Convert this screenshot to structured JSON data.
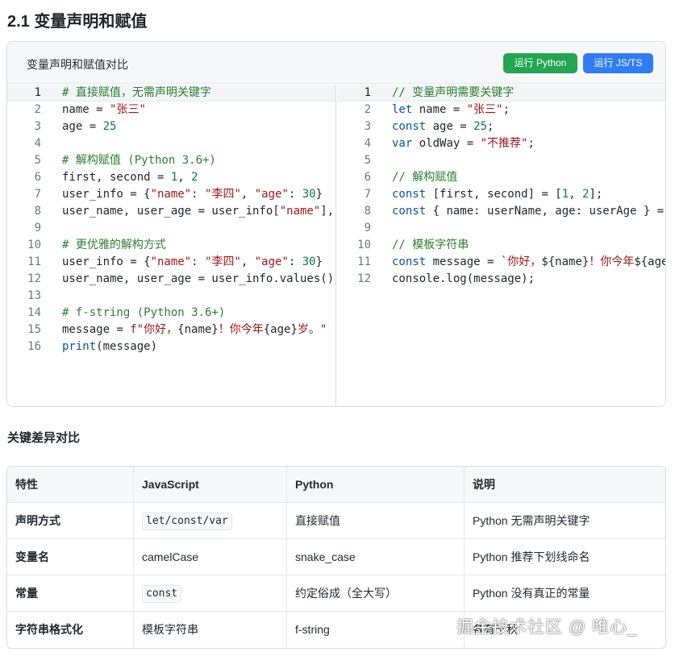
{
  "page": {
    "section_title": "2.1 变量声明和赋值",
    "watermark": "掘金技术社区 @ 唯心_"
  },
  "card": {
    "title": "变量声明和赋值对比",
    "run_python": "运行 Python",
    "run_js": "运行 JS/TS"
  },
  "code_python": [
    {
      "n": "1",
      "tokens": [
        {
          "t": "# 直接赋值，无需声明关键字",
          "c": "comment"
        }
      ]
    },
    {
      "n": "2",
      "tokens": [
        {
          "t": "name = ",
          "c": "plain"
        },
        {
          "t": "\"张三\"",
          "c": "str"
        }
      ]
    },
    {
      "n": "3",
      "tokens": [
        {
          "t": "age = ",
          "c": "plain"
        },
        {
          "t": "25",
          "c": "num"
        }
      ]
    },
    {
      "n": "4",
      "tokens": []
    },
    {
      "n": "5",
      "tokens": [
        {
          "t": "# 解构赋值 (Python 3.6+)",
          "c": "comment"
        }
      ]
    },
    {
      "n": "6",
      "tokens": [
        {
          "t": "first, second = ",
          "c": "plain"
        },
        {
          "t": "1",
          "c": "num"
        },
        {
          "t": ", ",
          "c": "plain"
        },
        {
          "t": "2",
          "c": "num"
        }
      ]
    },
    {
      "n": "7",
      "tokens": [
        {
          "t": "user_info = {",
          "c": "plain"
        },
        {
          "t": "\"name\"",
          "c": "str"
        },
        {
          "t": ": ",
          "c": "plain"
        },
        {
          "t": "\"李四\"",
          "c": "str"
        },
        {
          "t": ", ",
          "c": "plain"
        },
        {
          "t": "\"age\"",
          "c": "str"
        },
        {
          "t": ": ",
          "c": "plain"
        },
        {
          "t": "30",
          "c": "num"
        },
        {
          "t": "}",
          "c": "plain"
        }
      ]
    },
    {
      "n": "8",
      "tokens": [
        {
          "t": "user_name, user_age = user_info[",
          "c": "plain"
        },
        {
          "t": "\"name\"",
          "c": "str"
        },
        {
          "t": "],",
          "c": "plain"
        }
      ]
    },
    {
      "n": "9",
      "tokens": []
    },
    {
      "n": "10",
      "tokens": [
        {
          "t": "# 更优雅的解构方式",
          "c": "comment"
        }
      ]
    },
    {
      "n": "11",
      "tokens": [
        {
          "t": "user_info = {",
          "c": "plain"
        },
        {
          "t": "\"name\"",
          "c": "str"
        },
        {
          "t": ": ",
          "c": "plain"
        },
        {
          "t": "\"李四\"",
          "c": "str"
        },
        {
          "t": ", ",
          "c": "plain"
        },
        {
          "t": "\"age\"",
          "c": "str"
        },
        {
          "t": ": ",
          "c": "plain"
        },
        {
          "t": "30",
          "c": "num"
        },
        {
          "t": "}",
          "c": "plain"
        }
      ]
    },
    {
      "n": "12",
      "tokens": [
        {
          "t": "user_name, user_age = user_info.values()",
          "c": "plain"
        }
      ]
    },
    {
      "n": "13",
      "tokens": []
    },
    {
      "n": "14",
      "tokens": [
        {
          "t": "# f-string (Python 3.6+)",
          "c": "comment"
        }
      ]
    },
    {
      "n": "15",
      "tokens": [
        {
          "t": "message = ",
          "c": "plain"
        },
        {
          "t": "f\"你好，",
          "c": "str"
        },
        {
          "t": "{name}",
          "c": "plain"
        },
        {
          "t": "！你今年",
          "c": "str"
        },
        {
          "t": "{age}",
          "c": "plain"
        },
        {
          "t": "岁。\"",
          "c": "str"
        }
      ]
    },
    {
      "n": "16",
      "tokens": [
        {
          "t": "print",
          "c": "fn"
        },
        {
          "t": "(message)",
          "c": "plain"
        }
      ]
    }
  ],
  "code_js": [
    {
      "n": "1",
      "tokens": [
        {
          "t": "// 变量声明需要关键字",
          "c": "comment"
        }
      ]
    },
    {
      "n": "2",
      "tokens": [
        {
          "t": "let",
          "c": "kw"
        },
        {
          "t": " name = ",
          "c": "plain"
        },
        {
          "t": "\"张三\"",
          "c": "str"
        },
        {
          "t": ";",
          "c": "plain"
        }
      ]
    },
    {
      "n": "3",
      "tokens": [
        {
          "t": "const",
          "c": "kw"
        },
        {
          "t": " age = ",
          "c": "plain"
        },
        {
          "t": "25",
          "c": "num"
        },
        {
          "t": ";",
          "c": "plain"
        }
      ]
    },
    {
      "n": "4",
      "tokens": [
        {
          "t": "var",
          "c": "kw"
        },
        {
          "t": " oldWay = ",
          "c": "plain"
        },
        {
          "t": "\"不推荐\"",
          "c": "str"
        },
        {
          "t": ";",
          "c": "plain"
        }
      ]
    },
    {
      "n": "5",
      "tokens": []
    },
    {
      "n": "6",
      "tokens": [
        {
          "t": "// 解构赋值",
          "c": "comment"
        }
      ]
    },
    {
      "n": "7",
      "tokens": [
        {
          "t": "const",
          "c": "kw"
        },
        {
          "t": " [first, second] = [",
          "c": "plain"
        },
        {
          "t": "1",
          "c": "num"
        },
        {
          "t": ", ",
          "c": "plain"
        },
        {
          "t": "2",
          "c": "num"
        },
        {
          "t": "];",
          "c": "plain"
        }
      ]
    },
    {
      "n": "8",
      "tokens": [
        {
          "t": "const",
          "c": "kw"
        },
        {
          "t": " { name: userName, age: userAge } = ",
          "c": "plain"
        }
      ]
    },
    {
      "n": "9",
      "tokens": []
    },
    {
      "n": "10",
      "tokens": [
        {
          "t": "// 模板字符串",
          "c": "comment"
        }
      ]
    },
    {
      "n": "11",
      "tokens": [
        {
          "t": "const",
          "c": "kw"
        },
        {
          "t": " message = ",
          "c": "plain"
        },
        {
          "t": "`你好，",
          "c": "str"
        },
        {
          "t": "${name}",
          "c": "plain"
        },
        {
          "t": "！你今年",
          "c": "str"
        },
        {
          "t": "${age",
          "c": "plain"
        }
      ]
    },
    {
      "n": "12",
      "tokens": [
        {
          "t": "console.log(message);",
          "c": "plain"
        }
      ]
    }
  ],
  "diff": {
    "title": "关键差异对比",
    "headers": [
      "特性",
      "JavaScript",
      "Python",
      "说明"
    ],
    "rows": [
      {
        "feature": "声明方式",
        "js": "let/const/var",
        "js_code": true,
        "py": "直接赋值",
        "note": "Python 无需声明关键字"
      },
      {
        "feature": "变量名",
        "js": "camelCase",
        "js_code": false,
        "py": "snake_case",
        "note": "Python 推荐下划线命名"
      },
      {
        "feature": "常量",
        "js": "const",
        "js_code": true,
        "py": "约定俗成（全大写）",
        "note": "Python 没有真正的常量"
      },
      {
        "feature": "字符串格式化",
        "js": "模板字符串",
        "js_code": false,
        "py": "f-string",
        "note": "各有千秋"
      }
    ]
  },
  "colors": {
    "run_python_bg": "#22a652",
    "run_js_bg": "#2f7df6",
    "comment": "#2e7d32",
    "string": "#a31515",
    "number": "#0b7a4b",
    "keyword": "#0f4fa8"
  }
}
